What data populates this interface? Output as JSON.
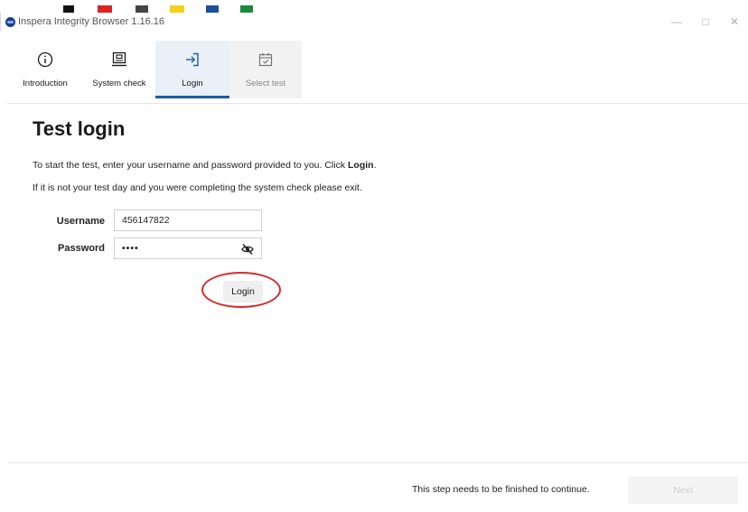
{
  "window": {
    "title": "Inspera Integrity Browser 1.16.16",
    "controls": {
      "minimize": "—",
      "maximize": "□",
      "close": "✕"
    }
  },
  "steps": [
    {
      "label": "Introduction",
      "icon": "info-icon",
      "state": "done"
    },
    {
      "label": "System check",
      "icon": "laptop-check-icon",
      "state": "done"
    },
    {
      "label": "Login",
      "icon": "sign-in-icon",
      "state": "active"
    },
    {
      "label": "Select test",
      "icon": "calendar-check-icon",
      "state": "disabled"
    }
  ],
  "main": {
    "title": "Test login",
    "instruction_prefix": "To start the test, enter your username and password provided to you. Click ",
    "instruction_bold": "Login",
    "instruction_suffix": ".",
    "note": "If it is not your test day and you were completing the system check please exit."
  },
  "form": {
    "username_label": "Username",
    "username_value": "456147822",
    "password_label": "Password",
    "password_value": "••••",
    "login_label": "Login"
  },
  "footer": {
    "message": "This step needs to be finished to continue.",
    "next_label": "Next"
  },
  "colors": {
    "accent": "#1e5aa8",
    "annotation": "#d42b2b",
    "active_tab_bg": "#eaf0f7"
  }
}
